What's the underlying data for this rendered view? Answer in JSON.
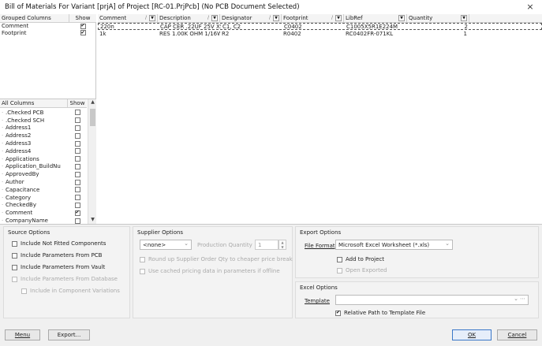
{
  "window": {
    "title": "Bill of Materials For Variant [prjA] of Project [RC-01.PrjPcb] (No PCB Document Selected)",
    "close_glyph": "×"
  },
  "grouped_columns": {
    "header": "Grouped Columns",
    "show_header": "Show",
    "rows": [
      {
        "name": "Comment",
        "checked": true
      },
      {
        "name": "Footprint",
        "checked": true
      }
    ]
  },
  "all_columns": {
    "header": "All Columns",
    "show_header": "Show",
    "rows": [
      {
        "name": ".Checked PCB",
        "checked": false
      },
      {
        "name": ".Checked SCH",
        "checked": false
      },
      {
        "name": "Address1",
        "checked": false
      },
      {
        "name": "Address2",
        "checked": false
      },
      {
        "name": "Address3",
        "checked": false
      },
      {
        "name": "Address4",
        "checked": false
      },
      {
        "name": "Applications",
        "checked": false
      },
      {
        "name": "Application_BuildNu",
        "checked": false
      },
      {
        "name": "ApprovedBy",
        "checked": false
      },
      {
        "name": "Author",
        "checked": false
      },
      {
        "name": "Capacitance",
        "checked": false
      },
      {
        "name": "Category",
        "checked": false
      },
      {
        "name": "CheckedBy",
        "checked": false
      },
      {
        "name": "Comment",
        "checked": true
      },
      {
        "name": "CompanyName",
        "checked": false
      }
    ]
  },
  "bom_table": {
    "columns": [
      "Comment",
      "Description",
      "Designator",
      "Footprint",
      "LibRef",
      "Quantity"
    ],
    "rows": [
      [
        "220n",
        "CAP CER .22UF 25V X5R",
        "C1, C2",
        "C0402",
        "C1005X5R1E224M",
        "2"
      ],
      [
        "1k",
        "RES 1.00K OHM 1/16W",
        "R2",
        "R0402",
        "RC0402FR-071KL",
        "1"
      ]
    ]
  },
  "source_options": {
    "title": "Source Options",
    "items": [
      {
        "label": "Include Not Fitted Components",
        "checked": false,
        "enabled": true
      },
      {
        "label": "Include Parameters From PCB",
        "checked": false,
        "enabled": true
      },
      {
        "label": "Include Parameters From Vault",
        "checked": false,
        "enabled": true
      },
      {
        "label": "Include Parameters From Database",
        "checked": false,
        "enabled": false
      },
      {
        "label": "Include in Component Variations",
        "checked": false,
        "enabled": false
      }
    ]
  },
  "supplier_options": {
    "title": "Supplier Options",
    "supplier_select": "<none>",
    "production_quantity_label": "Production Quantity",
    "production_quantity_value": "1",
    "round_up_label": "Round up Supplier Order Qty to cheaper price break",
    "cached_pricing_label": "Use cached pricing data in parameters if offline"
  },
  "export_options": {
    "title": "Export Options",
    "file_format_label": "File Format",
    "file_format_value": "Microsoft Excel Worksheet (*.xls)",
    "add_to_project_label": "Add to Project",
    "open_exported_label": "Open Exported"
  },
  "excel_options": {
    "title": "Excel Options",
    "template_label": "Template",
    "template_value": "",
    "relative_path_label": "Relative Path to Template File",
    "relative_path_checked": true
  },
  "buttons": {
    "menu": "Menu",
    "export": "Export...",
    "ok": "OK",
    "cancel": "Cancel"
  }
}
